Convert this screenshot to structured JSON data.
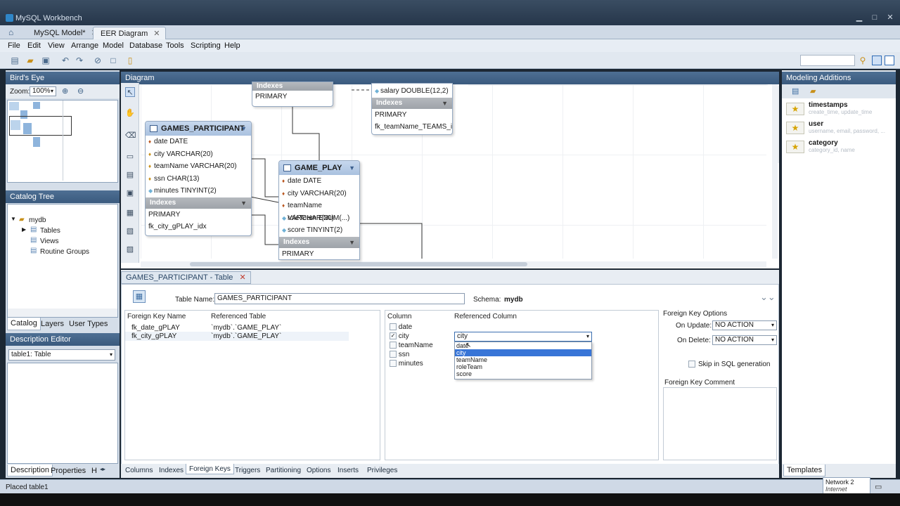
{
  "window": {
    "title": "MySQL Workbench"
  },
  "doc_tabs": [
    {
      "label": "MySQL Model*",
      "active": false
    },
    {
      "label": "EER Diagram",
      "active": true
    }
  ],
  "menu": [
    "File",
    "Edit",
    "View",
    "Arrange",
    "Model",
    "Database",
    "Tools",
    "Scripting",
    "Help"
  ],
  "left": {
    "birdseye_title": "Bird's Eye",
    "zoom_label": "Zoom:",
    "zoom_value": "100%",
    "catalog_title": "Catalog Tree",
    "tree": {
      "db": "mydb",
      "tables": "Tables",
      "views": "Views",
      "routines": "Routine Groups"
    },
    "tabs": [
      "Catalog",
      "Layers",
      "User Types"
    ],
    "desc_title": "Description Editor",
    "desc_select": "table1: Table",
    "bottom_tabs": [
      "Description",
      "Properties",
      "H"
    ]
  },
  "diagram": {
    "title": "Diagram",
    "entities": {
      "top_fragment": {
        "idx_header": "Indexes",
        "idx": [
          "PRIMARY"
        ]
      },
      "teams_fragment": {
        "col": "salary DOUBLE(12,2)",
        "idx_header": "Indexes",
        "idx": [
          "PRIMARY",
          "fk_teamName_TEAMS_idx"
        ]
      },
      "games_participant": {
        "name": "GAMES_PARTICIPANT",
        "columns": [
          "date DATE",
          "city VARCHAR(20)",
          "teamName VARCHAR(20)",
          "ssn CHAR(13)",
          "minutes TINYINT(2)"
        ],
        "idx_header": "Indexes",
        "idx": [
          "PRIMARY",
          "fk_city_gPLAY_idx"
        ]
      },
      "game_play": {
        "name": "GAME_PLAY",
        "columns": [
          "date DATE",
          "city VARCHAR(20)",
          "teamName VARCHAR(20)",
          "roleTeam ENUM(...)",
          "score TINYINT(2)"
        ],
        "idx_header": "Indexes",
        "idx": [
          "PRIMARY"
        ]
      }
    }
  },
  "editor": {
    "tab_label": "GAMES_PARTICIPANT - Table",
    "table_name_label": "Table Name:",
    "table_name_value": "GAMES_PARTICIPANT",
    "schema_label": "Schema:",
    "schema_value": "mydb",
    "fk_headers": [
      "Foreign Key Name",
      "Referenced Table"
    ],
    "fks": [
      {
        "name": "fk_date_gPLAY",
        "ref": "`mydb`.`GAME_PLAY`"
      },
      {
        "name": "fk_city_gPLAY",
        "ref": "`mydb`.`GAME_PLAY`"
      }
    ],
    "col_headers": [
      "Column",
      "Referenced Column"
    ],
    "columns": [
      {
        "name": "date",
        "checked": false
      },
      {
        "name": "city",
        "checked": true
      },
      {
        "name": "teamName",
        "checked": false
      },
      {
        "name": "ssn",
        "checked": false
      },
      {
        "name": "minutes",
        "checked": false
      }
    ],
    "ref_combo_value": "city",
    "ref_dropdown": [
      "date",
      "city",
      "teamName",
      "roleTeam",
      "score"
    ],
    "fk_options_title": "Foreign Key Options",
    "on_update_label": "On Update:",
    "on_update_value": "NO ACTION",
    "on_delete_label": "On Delete:",
    "on_delete_value": "NO ACTION",
    "skip_sql_label": "Skip in SQL generation",
    "fk_comment_title": "Foreign Key Comment",
    "bottom_tabs": [
      "Columns",
      "Indexes",
      "Foreign Keys",
      "Triggers",
      "Partitioning",
      "Options",
      "Inserts",
      "Privileges"
    ],
    "active_tab": "Foreign Keys"
  },
  "right": {
    "title": "Modeling Additions",
    "snippets": [
      {
        "title": "timestamps",
        "sub": "create_time, update_time"
      },
      {
        "title": "user",
        "sub": "username, email, password, ..."
      },
      {
        "title": "category",
        "sub": "category_id, name"
      }
    ],
    "templates_tab": "Templates"
  },
  "status": {
    "text": "Placed table1",
    "network_title": "Network 2",
    "network_sub": "Internet access"
  }
}
